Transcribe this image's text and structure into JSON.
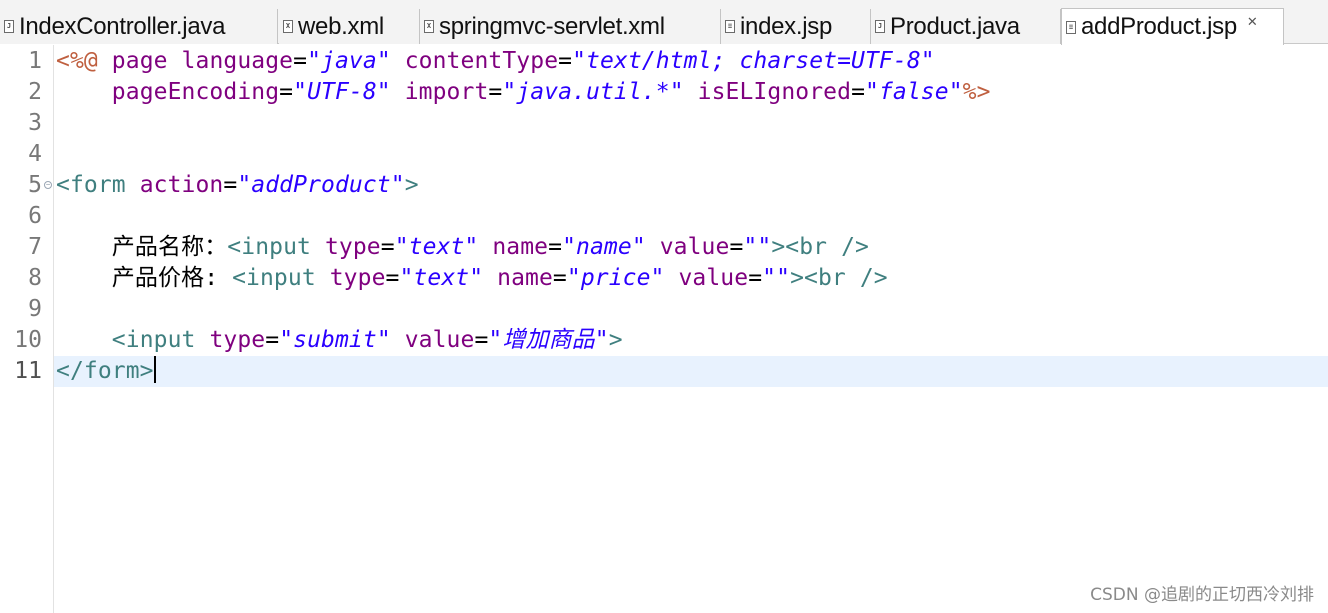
{
  "tabs": [
    {
      "label": "IndexController.java",
      "icon": "java-file-icon",
      "icon_glyph": "J"
    },
    {
      "label": "web.xml",
      "icon": "xml-file-icon",
      "icon_glyph": "X"
    },
    {
      "label": "springmvc-servlet.xml",
      "icon": "xml-file-icon",
      "icon_glyph": "X"
    },
    {
      "label": "index.jsp",
      "icon": "jsp-file-icon",
      "icon_glyph": "≡"
    },
    {
      "label": "Product.java",
      "icon": "java-file-icon",
      "icon_glyph": "J"
    },
    {
      "label": "addProduct.jsp",
      "icon": "jsp-file-icon",
      "icon_glyph": "≡",
      "active": true,
      "close": "✕"
    }
  ],
  "editor": {
    "current_line": 11,
    "lines": [
      {
        "num": "1",
        "tokens": [
          [
            "dir",
            "<%@ "
          ],
          [
            "attr",
            "page "
          ],
          [
            "attr",
            "language"
          ],
          [
            "txt",
            "="
          ],
          [
            "str",
            "\"java\""
          ],
          [
            "txt",
            " "
          ],
          [
            "attr",
            "contentType"
          ],
          [
            "txt",
            "="
          ],
          [
            "str",
            "\"text/html; charset=UTF-8\""
          ]
        ]
      },
      {
        "num": "2",
        "tokens": [
          [
            "txt",
            "    "
          ],
          [
            "attr",
            "pageEncoding"
          ],
          [
            "txt",
            "="
          ],
          [
            "str",
            "\"UTF-8\""
          ],
          [
            "txt",
            " "
          ],
          [
            "attr",
            "import"
          ],
          [
            "txt",
            "="
          ],
          [
            "str",
            "\"java.util.*\""
          ],
          [
            "txt",
            " "
          ],
          [
            "attr",
            "isELIgnored"
          ],
          [
            "txt",
            "="
          ],
          [
            "str",
            "\"false\""
          ],
          [
            "dir",
            "%>"
          ]
        ]
      },
      {
        "num": "3",
        "tokens": []
      },
      {
        "num": "4",
        "tokens": []
      },
      {
        "num": "5",
        "fold": true,
        "tokens": [
          [
            "tag",
            "<form "
          ],
          [
            "attr",
            "action"
          ],
          [
            "txt",
            "="
          ],
          [
            "str",
            "\"addProduct\""
          ],
          [
            "tag",
            ">"
          ]
        ]
      },
      {
        "num": "6",
        "tokens": []
      },
      {
        "num": "7",
        "tokens": [
          [
            "txt",
            "    产品名称："
          ],
          [
            "tag",
            "<input "
          ],
          [
            "attr",
            "type"
          ],
          [
            "txt",
            "="
          ],
          [
            "str",
            "\"text\""
          ],
          [
            "txt",
            " "
          ],
          [
            "attr",
            "name"
          ],
          [
            "txt",
            "="
          ],
          [
            "str",
            "\"name\""
          ],
          [
            "txt",
            " "
          ],
          [
            "attr",
            "value"
          ],
          [
            "txt",
            "="
          ],
          [
            "str",
            "\"\""
          ],
          [
            "tag",
            "><br />"
          ]
        ]
      },
      {
        "num": "8",
        "tokens": [
          [
            "txt",
            "    产品价格: "
          ],
          [
            "tag",
            "<input "
          ],
          [
            "attr",
            "type"
          ],
          [
            "txt",
            "="
          ],
          [
            "str",
            "\"text\""
          ],
          [
            "txt",
            " "
          ],
          [
            "attr",
            "name"
          ],
          [
            "txt",
            "="
          ],
          [
            "str",
            "\"price\""
          ],
          [
            "txt",
            " "
          ],
          [
            "attr",
            "value"
          ],
          [
            "txt",
            "="
          ],
          [
            "str",
            "\"\""
          ],
          [
            "tag",
            "><br />"
          ]
        ]
      },
      {
        "num": "9",
        "tokens": []
      },
      {
        "num": "10",
        "tokens": [
          [
            "txt",
            "    "
          ],
          [
            "tag",
            "<input "
          ],
          [
            "attr",
            "type"
          ],
          [
            "txt",
            "="
          ],
          [
            "str",
            "\"submit\""
          ],
          [
            "txt",
            " "
          ],
          [
            "attr",
            "value"
          ],
          [
            "txt",
            "="
          ],
          [
            "str",
            "\"增加商品\""
          ],
          [
            "tag",
            ">"
          ]
        ]
      },
      {
        "num": "11",
        "tokens": [
          [
            "tag",
            "</form>"
          ]
        ],
        "caret": true
      }
    ]
  },
  "watermark": "CSDN @追剧的正切西冷刘排",
  "colors": {
    "tag": "#3f7f7f",
    "attribute": "#7f007f",
    "string": "#2a00ff",
    "directive": "#bf5f3f",
    "current_line": "#e8f2fe"
  }
}
